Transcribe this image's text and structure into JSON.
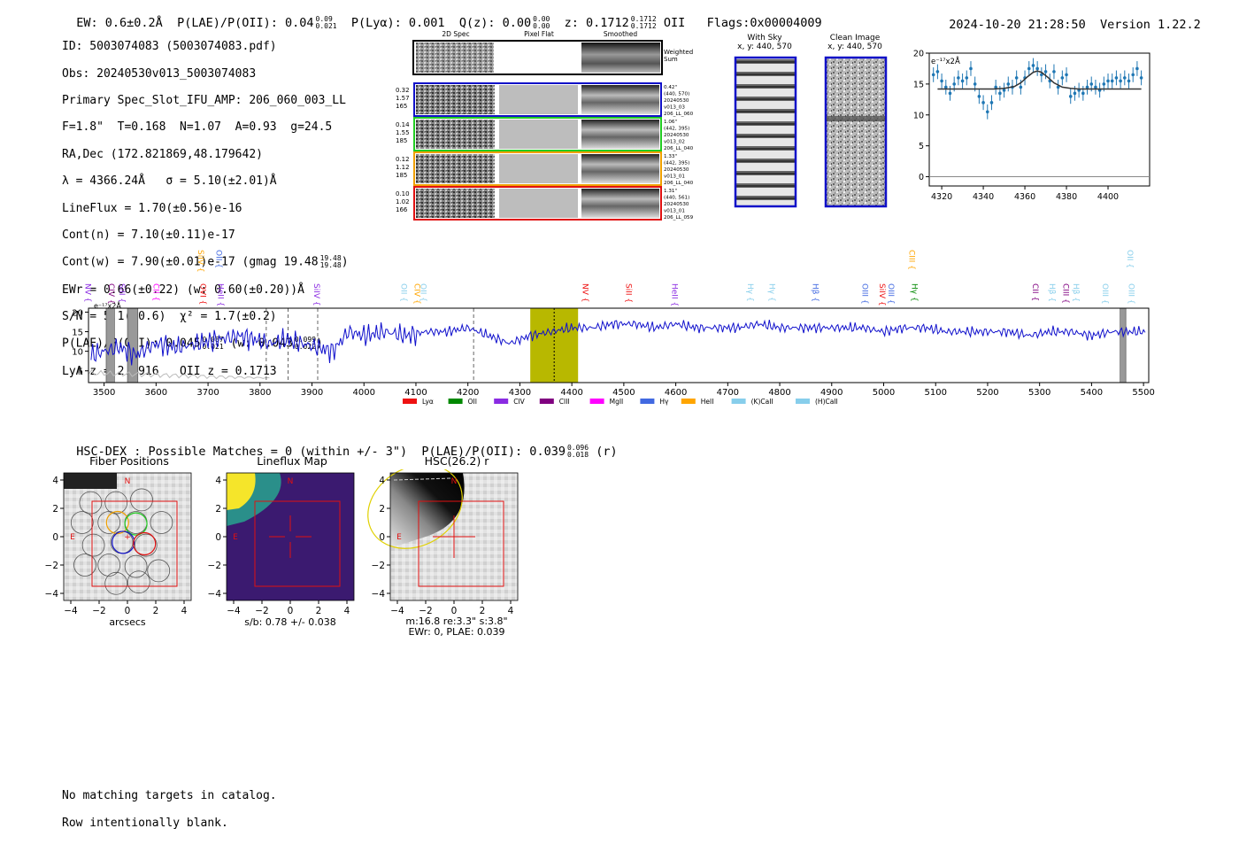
{
  "header": {
    "ew": "EW: 0.6±0.2Å",
    "plae_label": "P(LAE)/P(OII): 0.04",
    "plae_hi": "0.09",
    "plae_lo": "0.021",
    "plya": "P(Lyα): 0.001",
    "qz_label": "Q(z): 0.00",
    "qz_hi": "0.00",
    "qz_lo": "0.00",
    "z_label": "z: 0.1712",
    "z_hi": "0.1712",
    "z_lo": "0.1712",
    "z_type": "OII",
    "flags": "Flags:0x00004009",
    "datetime": "2024-10-20 21:28:50",
    "version": "Version 1.22.2"
  },
  "info": {
    "id": "ID: 5003074083 (5003074083.pdf)",
    "obs": "Obs: 20240530v013_5003074083",
    "primary": "Primary Spec_Slot_IFU_AMP: 206_060_003_LL",
    "params": "F=1.8\"  T=0.168  N=1.07  A=0.93  g=24.5",
    "radec": "RA,Dec (172.821869,48.179642)",
    "lambda": "λ = 4366.24Å   σ = 5.10(±2.01)Å",
    "lineflux": "LineFlux = 1.70(±0.56)e-16",
    "contn": "Cont(n) = 7.10(±0.11)e-17",
    "contw": "Cont(w) = 7.90(±0.01)e-17 (gmag 19.48",
    "contw_hi": "19.48",
    "contw_lo": "19.48",
    "contw_end": ")",
    "ewr": "EWr = 0.66(±0.22) (w: 0.60(±0.20))Å",
    "sn": "S/N = 5.1(±0.6)  χ² = 1.7(±0.2)",
    "plae": "P(LAE)/P(OII): 0.045",
    "plae_hi": "0.087",
    "plae_lo": "0.021",
    "plae_w": "(w: 0.043",
    "plae_w_hi": "0.099",
    "plae_w_lo": "0.022",
    "plae_w_end": ")",
    "lya_z": "LyA z = 2.5916   OII z = 0.1713"
  },
  "cutouts": {
    "col_2d": "2D Spec",
    "col_flat": "Pixel Flat",
    "col_smooth": "Smoothed",
    "weighted": "Weighted Sum",
    "rows": [
      {
        "left": [
          "0.32",
          "1.57",
          "165"
        ],
        "right": [
          "0.42\"",
          "(440, 570)",
          "20240530",
          "v013_03",
          "206_LL_060"
        ],
        "color": "#1010c8"
      },
      {
        "left": [
          "0.14",
          "1.55",
          "185"
        ],
        "right": [
          "1.06\"",
          "(442, 395)",
          "20240530",
          "v013_02",
          "206_LL_040"
        ],
        "color": "#22cc22"
      },
      {
        "left": [
          "0.12",
          "1.12",
          "185"
        ],
        "right": [
          "1.33\"",
          "(442, 395)",
          "20240530",
          "v013_01",
          "206_LL_040"
        ],
        "color": "#f0a000"
      },
      {
        "left": [
          "0.10",
          "1.02",
          "166"
        ],
        "right": [
          "1.31\"",
          "(440, 561)",
          "20240530",
          "v013_01",
          "206_LL_059"
        ],
        "color": "#e01010"
      }
    ]
  },
  "sky": {
    "with_sky_title": "With Sky",
    "with_sky_coords": "x, y: 440, 570",
    "clean_title": "Clean Image",
    "clean_coords": "x, y: 440, 570"
  },
  "colors": {
    "spectrum": "#1010cc",
    "fit_points": "#1f77b4",
    "highlight": "#b8b800",
    "lya": "#ee1111",
    "oii": "#008800",
    "civ": "#8a2be2",
    "ciii": "#800080",
    "mgii": "#ff00ff",
    "hy": "#4169e1",
    "heii": "#ffa500",
    "kcaii": "#87ceeb",
    "hcaii": "#87ceeb"
  },
  "legend": [
    {
      "label": "Lyα",
      "color": "#ee1111"
    },
    {
      "label": "OII",
      "color": "#008800"
    },
    {
      "label": "CIV",
      "color": "#8a2be2"
    },
    {
      "label": "CIII",
      "color": "#800080"
    },
    {
      "label": "MgII",
      "color": "#ff00ff"
    },
    {
      "label": "Hγ",
      "color": "#4169e1"
    },
    {
      "label": "HeII",
      "color": "#ffa500"
    },
    {
      "label": "(K)CaII",
      "color": "#87ceeb"
    },
    {
      "label": "(H)CaII",
      "color": "#87ceeb"
    }
  ],
  "line_marks": [
    {
      "name": "NV",
      "color": "#8a2be2",
      "wave": 3495,
      "row": 0
    },
    {
      "name": "CIV",
      "color": "#800080",
      "wave": 3540,
      "row": 0
    },
    {
      "name": "SiII",
      "color": "#8a2be2",
      "wave": 3560,
      "row": 0
    },
    {
      "name": "CII",
      "color": "#ff00ff",
      "wave": 3626,
      "row": 0
    },
    {
      "name": "SiIV",
      "color": "#ffa500",
      "wave": 3712,
      "row": 1
    },
    {
      "name": "OVI",
      "color": "#ee1111",
      "wave": 3716,
      "row": 0
    },
    {
      "name": "OII",
      "color": "#4169e1",
      "wave": 3747,
      "row": 1
    },
    {
      "name": "HeII",
      "color": "#8a2be2",
      "wave": 3750,
      "row": 0
    },
    {
      "name": "SiIV",
      "color": "#8a2be2",
      "wave": 3935,
      "row": 0
    },
    {
      "name": "OII",
      "color": "#87ceeb",
      "wave": 4103,
      "row": 0
    },
    {
      "name": "CIV",
      "color": "#ffa500",
      "wave": 4128,
      "row": 0
    },
    {
      "name": "OII",
      "color": "#87ceeb",
      "wave": 4140,
      "row": 0
    },
    {
      "name": "NV",
      "color": "#ee1111",
      "wave": 4452,
      "row": 0
    },
    {
      "name": "SiII",
      "color": "#ee1111",
      "wave": 4535,
      "row": 0
    },
    {
      "name": "HeII",
      "color": "#8a2be2",
      "wave": 4624,
      "row": 0
    },
    {
      "name": "Hγ",
      "color": "#87ceeb",
      "wave": 4769,
      "row": 0
    },
    {
      "name": "Hγ",
      "color": "#87ceeb",
      "wave": 4811,
      "row": 0
    },
    {
      "name": "Hβ",
      "color": "#4169e1",
      "wave": 4894,
      "row": 0
    },
    {
      "name": "OIII",
      "color": "#4169e1",
      "wave": 4990,
      "row": 0
    },
    {
      "name": "SiIV",
      "color": "#ee1111",
      "wave": 5023,
      "row": 0
    },
    {
      "name": "OIII",
      "color": "#4169e1",
      "wave": 5040,
      "row": 0
    },
    {
      "name": "CIII",
      "color": "#ffa500",
      "wave": 5080,
      "row": 1
    },
    {
      "name": "Hγ",
      "color": "#008800",
      "wave": 5085,
      "row": 0
    },
    {
      "name": "CII",
      "color": "#800080",
      "wave": 5318,
      "row": 0
    },
    {
      "name": "Hβ",
      "color": "#87ceeb",
      "wave": 5350,
      "row": 0
    },
    {
      "name": "CIII",
      "color": "#800080",
      "wave": 5376,
      "row": 0
    },
    {
      "name": "Hβ",
      "color": "#87ceeb",
      "wave": 5396,
      "row": 0
    },
    {
      "name": "OIII",
      "color": "#87ceeb",
      "wave": 5452,
      "row": 0
    },
    {
      "name": "OII",
      "color": "#87ceeb",
      "wave": 5500,
      "row": 1
    },
    {
      "name": "OIII",
      "color": "#87ceeb",
      "wave": 5502,
      "row": 0
    }
  ],
  "chart_data": [
    {
      "type": "line",
      "ylabel": "e⁻¹⁷x2Å",
      "xlim": [
        3470,
        5510
      ],
      "ylim": [
        2,
        21
      ],
      "xticks": [
        3500,
        3600,
        3700,
        3800,
        3900,
        4000,
        4100,
        4200,
        4300,
        4400,
        4500,
        4600,
        4700,
        4800,
        4900,
        5000,
        5100,
        5200,
        5300,
        5400,
        5500
      ],
      "yticks": [
        5,
        10,
        15,
        20
      ],
      "highlight_band": [
        4320,
        4412
      ],
      "line_center": 4366,
      "dashed_lines": [
        3812,
        3854,
        3911,
        4211
      ],
      "hatched_bands": [
        [
          3504,
          3520
        ],
        [
          3545,
          3565
        ],
        [
          5455,
          5466
        ]
      ],
      "series": [
        {
          "name": "",
          "x": [
            3475,
            3500,
            3530,
            3560,
            3600,
            3640,
            3680,
            3720,
            3760,
            3790,
            3820,
            3850,
            3880,
            3910,
            3940,
            3970,
            4000,
            4040,
            4080,
            4120,
            4160,
            4200,
            4240,
            4280,
            4320,
            4360,
            4400,
            4440,
            4480,
            4520,
            4560,
            4600,
            4640,
            4680,
            4720,
            4760,
            4800,
            4840,
            4880,
            4920,
            4960,
            5000,
            5040,
            5080,
            5120,
            5160,
            5200,
            5240,
            5280,
            5320,
            5360,
            5400,
            5440,
            5480,
            5505
          ],
          "y": [
            9,
            10,
            11,
            9,
            12,
            11,
            12,
            13,
            14,
            13,
            12,
            13,
            12,
            11,
            10,
            15,
            14,
            15,
            14,
            15,
            15,
            16,
            14,
            12,
            14,
            15,
            16,
            16,
            17,
            17,
            16,
            17,
            16,
            16,
            16,
            17,
            16,
            16,
            16,
            16,
            16,
            15,
            16,
            16,
            15,
            15,
            15,
            15,
            14,
            15,
            15,
            14,
            15,
            15,
            15
          ]
        }
      ]
    },
    {
      "type": "scatter",
      "ylabel": "e⁻¹⁷x2Å",
      "xlim": [
        4314,
        4420
      ],
      "ylim": [
        -1.5,
        20
      ],
      "xticks": [
        4320,
        4340,
        4360,
        4380,
        4400
      ],
      "yticks": [
        0,
        5,
        10,
        15,
        20
      ],
      "series": [
        {
          "name": "",
          "x": [
            4316,
            4318,
            4320,
            4322,
            4324,
            4326,
            4328,
            4330,
            4332,
            4334,
            4336,
            4338,
            4340,
            4342,
            4344,
            4346,
            4348,
            4350,
            4352,
            4354,
            4356,
            4358,
            4360,
            4362,
            4364,
            4366,
            4368,
            4370,
            4372,
            4374,
            4376,
            4378,
            4380,
            4382,
            4384,
            4386,
            4388,
            4390,
            4392,
            4394,
            4396,
            4398,
            4400,
            4402,
            4404,
            4406,
            4408,
            4410,
            4412,
            4414,
            4416
          ],
          "y": [
            16.5,
            17,
            15.5,
            14.5,
            13.5,
            15,
            16,
            15.5,
            16,
            17.5,
            15,
            13,
            12,
            10.5,
            12,
            14.5,
            13.5,
            14,
            15,
            14.5,
            16,
            14.5,
            16,
            17.5,
            18,
            17.5,
            16.5,
            17,
            15.5,
            17,
            14.5,
            16,
            16.5,
            13,
            13.5,
            14,
            13.5,
            14.5,
            15,
            14.5,
            14,
            15,
            15.5,
            15.5,
            16,
            15.5,
            16,
            15.5,
            16.5,
            17.5,
            16
          ]
        },
        {
          "name": "",
          "x": [
            4318,
            4320,
            4325,
            4330,
            4335,
            4340,
            4345,
            4350,
            4355,
            4358,
            4361,
            4364,
            4366,
            4368,
            4371,
            4374,
            4378,
            4382,
            4386,
            4390,
            4400,
            4410,
            4416
          ],
          "y": [
            14.2,
            14.2,
            14.2,
            14.2,
            14.2,
            14.2,
            14.2,
            14.3,
            14.6,
            15.2,
            16.1,
            16.9,
            17.1,
            16.9,
            16.1,
            15.2,
            14.5,
            14.3,
            14.2,
            14.2,
            14.2,
            14.2,
            14.2
          ]
        }
      ]
    }
  ],
  "hsc": {
    "summary_label": "HSC-DEX : Possible Matches = 0 (within +/- 3\")  P(LAE)/P(OII): 0.039",
    "summary_hi": "0.096",
    "summary_lo": "0.018",
    "summary_band": "(r)",
    "fiber_title": "Fiber Positions",
    "fiber_xlabel": "arcsecs",
    "lineflux_title": "Lineflux Map",
    "lineflux_xlabel": "s/b: 0.78 +/- 0.038",
    "hsc_title": "HSC(26.2) r",
    "hsc_xlabel1": "m:16.8  re:3.3\"  s:3.8\"",
    "hsc_xlabel2": "EWr: 0, PLAE: 0.039",
    "north": "N",
    "east": "E",
    "ticks": [
      "−4",
      "−2",
      "0",
      "2",
      "4"
    ],
    "yticks": [
      "4",
      "2",
      "0",
      "−2",
      "−4"
    ]
  },
  "footer": {
    "line1": "No matching targets in catalog.",
    "line2": "Row intentionally blank."
  }
}
